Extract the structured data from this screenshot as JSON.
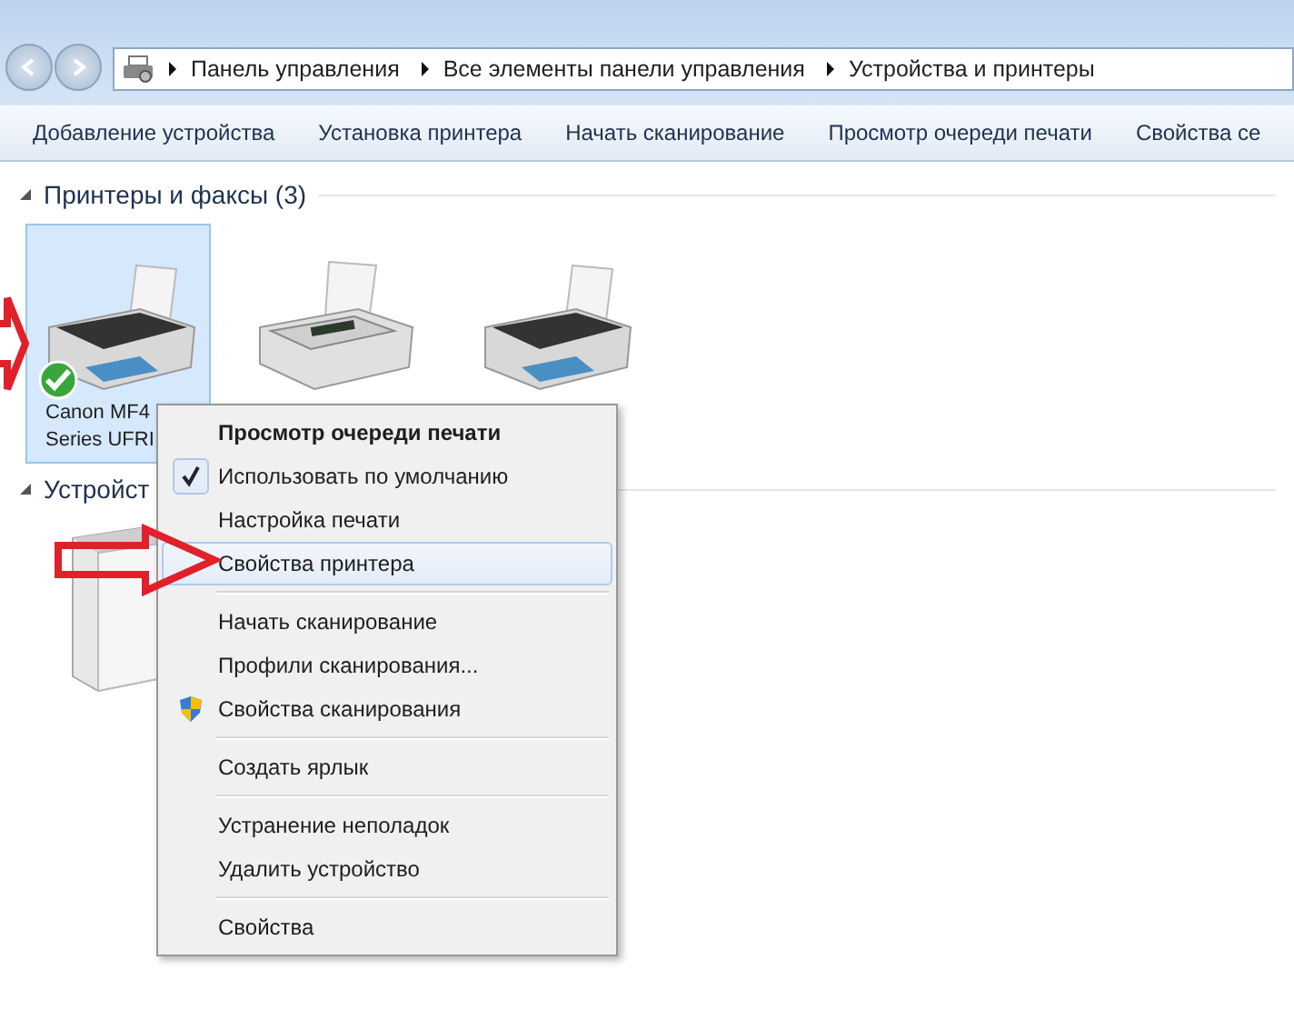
{
  "address_bar": {
    "path": [
      "Панель управления",
      "Все элементы панели управления",
      "Устройства и принтеры"
    ]
  },
  "toolbar": [
    "Добавление устройства",
    "Установка принтера",
    "Начать сканирование",
    "Просмотр очереди печати",
    "Свойства се"
  ],
  "sections": [
    {
      "title": "Принтеры и факсы (3)",
      "expanded": true,
      "devices": [
        {
          "kind": "printer",
          "label_lines": [
            "Canon MF4",
            "Series UFRI"
          ],
          "selected": true,
          "default": true
        },
        {
          "kind": "fax",
          "selected": false,
          "default": false
        },
        {
          "kind": "printer",
          "selected": false,
          "default": false
        }
      ]
    },
    {
      "title": "Устройст",
      "expanded": true,
      "devices": [
        {
          "kind": "tower",
          "selected": false,
          "default": false
        }
      ]
    }
  ],
  "context_menu": [
    {
      "kind": "item",
      "label": "Просмотр очереди печати",
      "bold": true,
      "selected": false
    },
    {
      "kind": "checked",
      "label": "Использовать по умолчанию",
      "bold": false,
      "selected": false
    },
    {
      "kind": "item",
      "label": "Настройка печати",
      "bold": false,
      "selected": false
    },
    {
      "kind": "item",
      "label": "Свойства принтера",
      "bold": false,
      "selected": true
    },
    {
      "kind": "separator"
    },
    {
      "kind": "item",
      "label": "Начать сканирование",
      "bold": false,
      "selected": false
    },
    {
      "kind": "item",
      "label": "Профили сканирования...",
      "bold": false,
      "selected": false
    },
    {
      "kind": "shield",
      "label": "Свойства сканирования",
      "bold": false,
      "selected": false
    },
    {
      "kind": "separator"
    },
    {
      "kind": "item",
      "label": "Создать ярлык",
      "bold": false,
      "selected": false
    },
    {
      "kind": "separator"
    },
    {
      "kind": "item",
      "label": "Устранение неполадок",
      "bold": false,
      "selected": false
    },
    {
      "kind": "item",
      "label": "Удалить устройство",
      "bold": false,
      "selected": false
    },
    {
      "kind": "separator"
    },
    {
      "kind": "item",
      "label": "Свойства",
      "bold": false,
      "selected": false
    }
  ]
}
